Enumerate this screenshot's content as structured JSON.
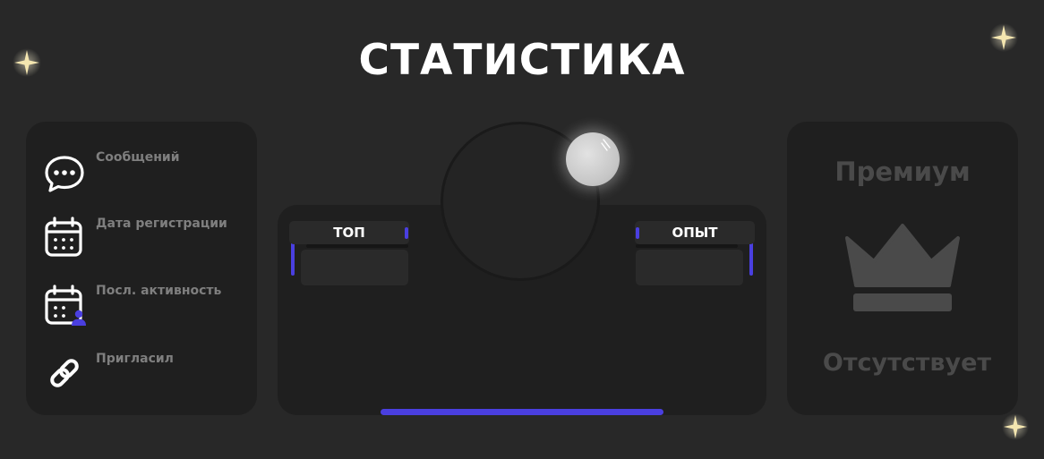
{
  "title": "СТАТИСТИКА",
  "stats": {
    "messages_label": "Сообщений",
    "registration_label": "Дата регистрации",
    "last_activity_label": "Посл. активность",
    "invited_label": "Пригласил"
  },
  "profile": {
    "top_label": "ТОП",
    "exp_label": "ОПЫТ",
    "top_value": "",
    "exp_value": ""
  },
  "premium": {
    "title": "Премиум",
    "status": "Отсутствует"
  },
  "colors": {
    "background": "#282828",
    "panel": "#1f1f1f",
    "accent": "#4a3fe0",
    "muted_text": "#7f7f7f",
    "premium_gray": "#4a4a4a"
  },
  "icons": {
    "messages": "chat-bubble-icon",
    "registration": "calendar-icon",
    "last_activity": "calendar-user-icon",
    "invited": "link-icon",
    "premium": "crown-icon",
    "decor": "sparkle-icon"
  }
}
